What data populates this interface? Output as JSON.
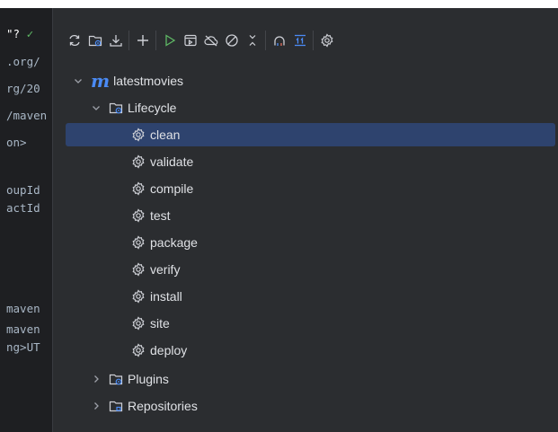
{
  "editor": {
    "lines": [
      {
        "text": "\"?",
        "mark": "✓"
      },
      {
        "text": ".org/"
      },
      {
        "text": "rg/20"
      },
      {
        "text": "/maven"
      },
      {
        "text": "on>"
      },
      {
        "text": ""
      },
      {
        "text": "oupId"
      },
      {
        "text": "actId"
      },
      {
        "text": ""
      },
      {
        "text": ""
      },
      {
        "text": ""
      },
      {
        "text": "maven"
      },
      {
        "text": "maven"
      },
      {
        "text": "ng>UT"
      }
    ]
  },
  "toolbar": {
    "icons": [
      "reload-icon",
      "generate-sources-icon",
      "download-icon",
      "add-icon",
      "run-icon",
      "execute-goal-icon",
      "offline-icon",
      "skip-tests-icon",
      "collapse-all-icon",
      "analyze-dependencies-icon",
      "show-dependencies-icon",
      "settings-icon"
    ]
  },
  "tree": {
    "project": "latestmovies",
    "lifecycle_label": "Lifecycle",
    "goals": [
      "clean",
      "validate",
      "compile",
      "test",
      "package",
      "verify",
      "install",
      "site",
      "deploy"
    ],
    "selected_goal": "clean",
    "plugins_label": "Plugins",
    "repositories_label": "Repositories"
  },
  "colors": {
    "panel_bg": "#2b2d30",
    "selection": "#2e436e",
    "accent": "#4b8bf5",
    "run_green": "#5fb865"
  }
}
